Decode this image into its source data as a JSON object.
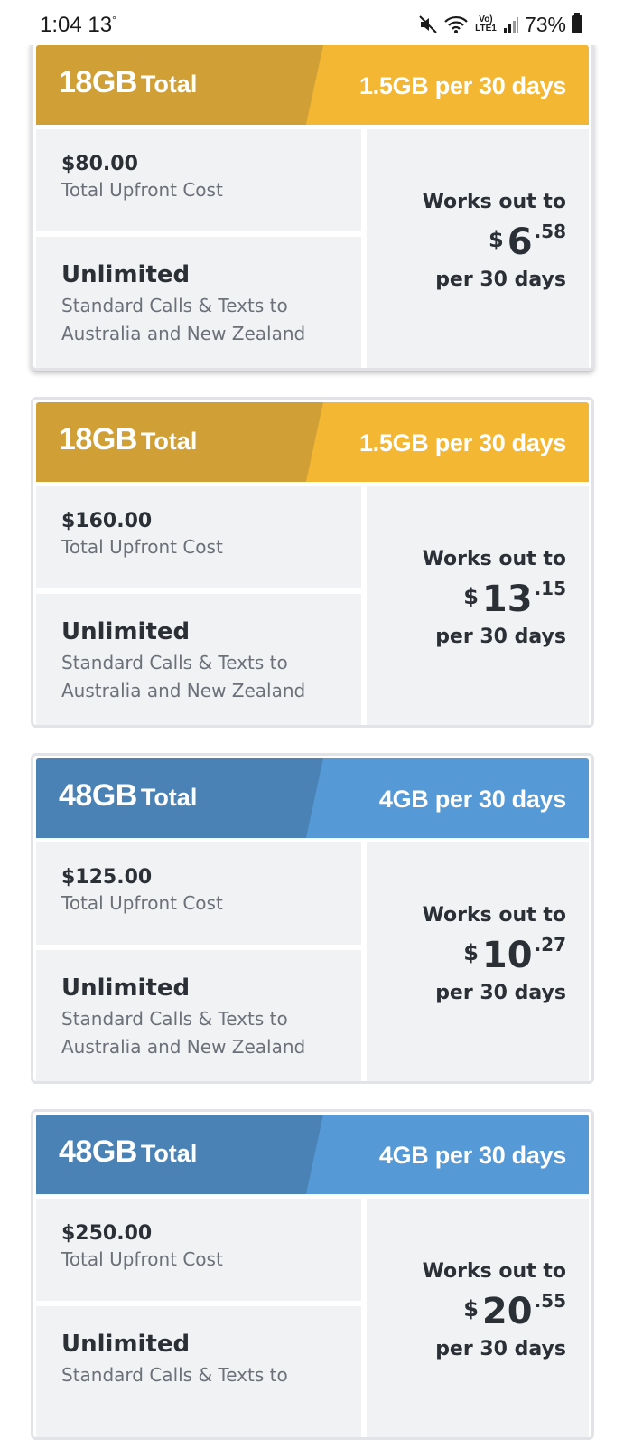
{
  "status_bar": {
    "time": "1:04",
    "temperature": "13",
    "temperature_unit": "°",
    "volte_line1": "Vo)",
    "volte_line2": "LTE1",
    "battery_percent": "73%",
    "icons": [
      "mute-icon",
      "wifi-icon",
      "volte-icon",
      "signal-icon",
      "battery-icon"
    ]
  },
  "plans": [
    {
      "total_amount": "18GB",
      "total_word": "Total",
      "per_period": "1.5GB per 30 days",
      "upfront_price": "$80.00",
      "upfront_caption": "Total Upfront Cost",
      "calls_title": "Unlimited",
      "calls_desc": "Standard Calls & Texts to Australia and New Zealand",
      "works_label": "Works out to",
      "works_dollar": "$",
      "works_whole": "6",
      "works_cents": ".58",
      "works_period": "per 30 days",
      "header_color_left": "#d0a037",
      "header_color_right": "#f3b733"
    },
    {
      "total_amount": "18GB",
      "total_word": "Total",
      "per_period": "1.5GB per 30 days",
      "upfront_price": "$160.00",
      "upfront_caption": "Total Upfront Cost",
      "calls_title": "Unlimited",
      "calls_desc": "Standard Calls & Texts to Australia and New Zealand",
      "works_label": "Works out to",
      "works_dollar": "$",
      "works_whole": "13",
      "works_cents": ".15",
      "works_period": "per 30 days",
      "header_color_left": "#d0a037",
      "header_color_right": "#f3b733"
    },
    {
      "total_amount": "48GB",
      "total_word": "Total",
      "per_period": "4GB per 30 days",
      "upfront_price": "$125.00",
      "upfront_caption": "Total Upfront Cost",
      "calls_title": "Unlimited",
      "calls_desc": "Standard Calls & Texts to Australia and New Zealand",
      "works_label": "Works out to",
      "works_dollar": "$",
      "works_whole": "10",
      "works_cents": ".27",
      "works_period": "per 30 days",
      "header_color_left": "#4a82b5",
      "header_color_right": "#5599d6"
    },
    {
      "total_amount": "48GB",
      "total_word": "Total",
      "per_period": "4GB per 30 days",
      "upfront_price": "$250.00",
      "upfront_caption": "Total Upfront Cost",
      "calls_title": "Unlimited",
      "calls_desc": "Standard Calls & Texts to",
      "works_label": "Works out to",
      "works_dollar": "$",
      "works_whole": "20",
      "works_cents": ".55",
      "works_period": "per 30 days",
      "header_color_left": "#4a82b5",
      "header_color_right": "#5599d6"
    }
  ]
}
